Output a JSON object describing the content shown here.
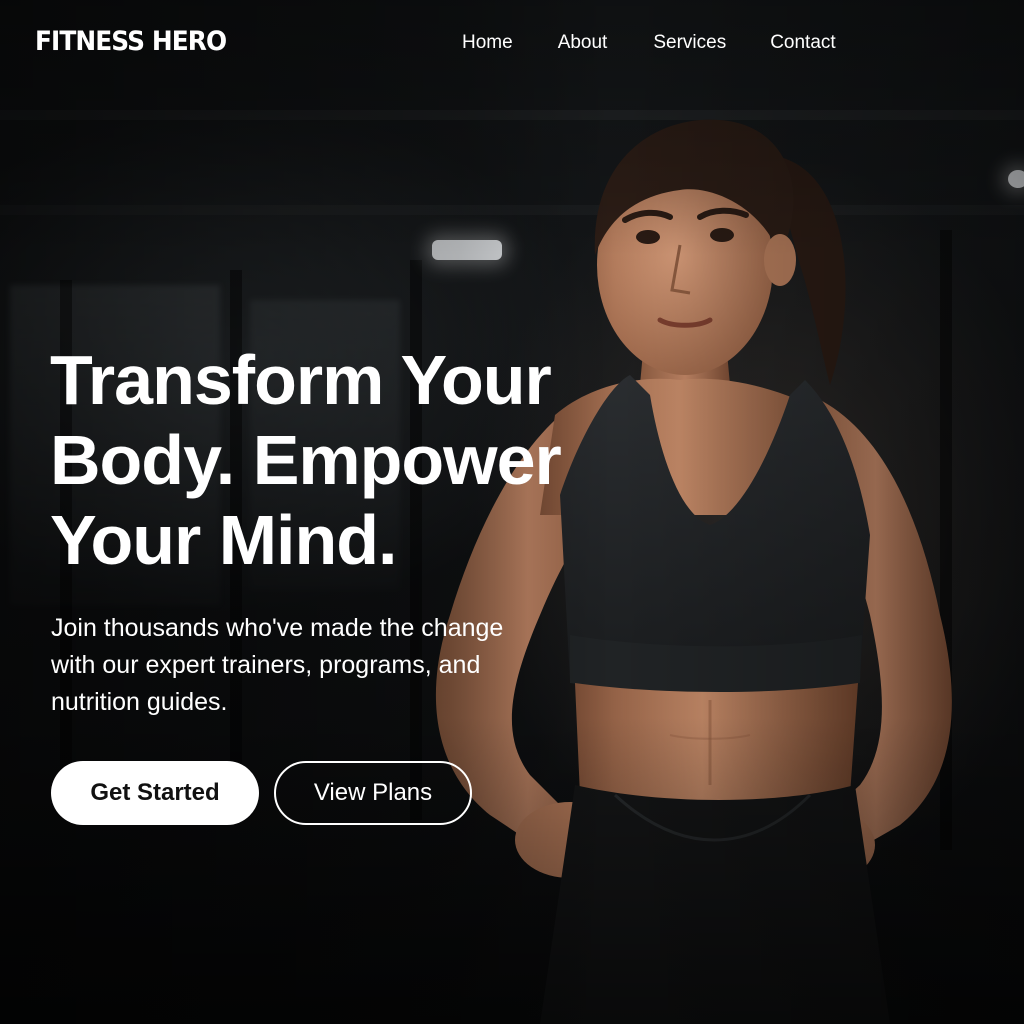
{
  "brand": {
    "name": "FITNESS HERO"
  },
  "nav": {
    "items": [
      {
        "label": "Home"
      },
      {
        "label": "About"
      },
      {
        "label": "Services"
      },
      {
        "label": "Contact"
      }
    ]
  },
  "hero": {
    "headline": "Transform Your Body. Empower Your Mind.",
    "subtext": "Join thousands who've made the change with our expert trainers, programs, and nutrition guides.",
    "primary_cta": "Get Started",
    "secondary_cta": "View Plans",
    "image": "athlete-photo"
  },
  "colors": {
    "background": "#0f1112",
    "text": "#ffffff",
    "primary_button_bg": "#ffffff",
    "primary_button_text": "#111111"
  }
}
